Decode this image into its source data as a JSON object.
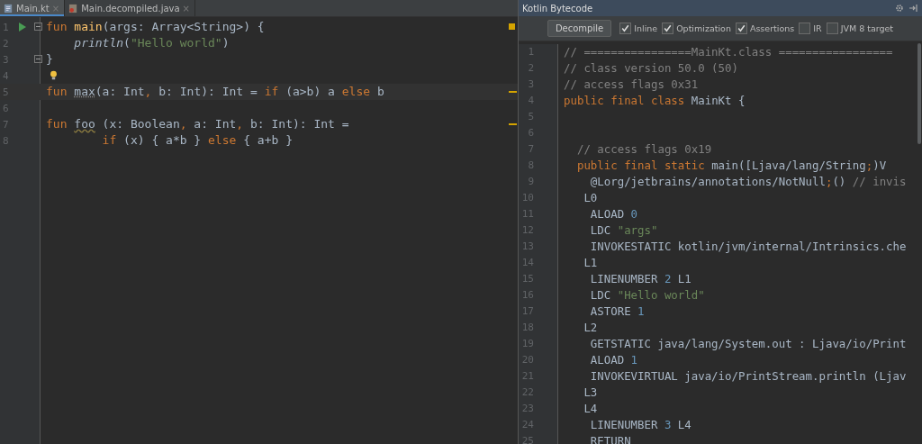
{
  "editor": {
    "tabs": [
      {
        "label": "Main.kt",
        "close": "×",
        "selected": true,
        "kind": "kotlin"
      },
      {
        "label": "Main.decompiled.java",
        "close": "×",
        "selected": false,
        "kind": "java"
      }
    ],
    "lines": [
      {
        "number": "1",
        "run": true,
        "fold_start": true,
        "fold_end": false,
        "bulb": false,
        "current": false,
        "warning": false,
        "tokens": [
          {
            "kind": "keyword",
            "text": "fun "
          },
          {
            "kind": "function",
            "text": "main"
          },
          {
            "kind": "plain",
            "text": "(args: Array<String>) {"
          }
        ]
      },
      {
        "number": "2",
        "run": false,
        "fold_start": false,
        "fold_end": false,
        "bulb": false,
        "current": false,
        "warning": false,
        "tokens": [
          {
            "kind": "italic",
            "text": "    println"
          },
          {
            "kind": "plain",
            "text": "("
          },
          {
            "kind": "string",
            "text": "\"Hello world\""
          },
          {
            "kind": "plain",
            "text": ")"
          }
        ]
      },
      {
        "number": "3",
        "run": false,
        "fold_start": false,
        "fold_end": true,
        "bulb": false,
        "current": false,
        "warning": false,
        "tokens": [
          {
            "kind": "plain",
            "text": "}"
          }
        ]
      },
      {
        "number": "4",
        "run": false,
        "fold_start": false,
        "fold_end": false,
        "bulb": true,
        "current": false,
        "warning": false
      },
      {
        "number": "5",
        "run": false,
        "fold_start": false,
        "fold_end": false,
        "bulb": false,
        "current": true,
        "warning": true,
        "tokens": [
          {
            "kind": "keyword",
            "text": "fun "
          },
          {
            "kind": "dotted",
            "text": "max"
          },
          {
            "kind": "plain",
            "text": "(a: Int"
          },
          {
            "kind": "keyword",
            "text": ","
          },
          {
            "kind": "plain",
            "text": " b: Int): Int = "
          },
          {
            "kind": "keyword",
            "text": "if"
          },
          {
            "kind": "plain",
            "text": " (a>b) a "
          },
          {
            "kind": "keyword",
            "text": "else"
          },
          {
            "kind": "plain",
            "text": " b"
          }
        ]
      },
      {
        "number": "6",
        "run": false,
        "fold_start": false,
        "fold_end": false,
        "bulb": false,
        "current": false,
        "warning": false
      },
      {
        "number": "7",
        "run": false,
        "fold_start": false,
        "fold_end": false,
        "bulb": false,
        "current": false,
        "warning": true,
        "tokens": [
          {
            "kind": "keyword",
            "text": "fun "
          },
          {
            "kind": "wavy",
            "text": "foo"
          },
          {
            "kind": "plain",
            "text": " (x: Boolean"
          },
          {
            "kind": "keyword",
            "text": ","
          },
          {
            "kind": "plain",
            "text": " a: Int"
          },
          {
            "kind": "keyword",
            "text": ","
          },
          {
            "kind": "plain",
            "text": " b: Int): Int ="
          }
        ]
      },
      {
        "number": "8",
        "run": false,
        "fold_start": false,
        "fold_end": false,
        "bulb": false,
        "current": false,
        "warning": false,
        "tokens": [
          {
            "kind": "keyword",
            "text": "        if"
          },
          {
            "kind": "plain",
            "text": " (x) { a*b } "
          },
          {
            "kind": "keyword",
            "text": "else"
          },
          {
            "kind": "plain",
            "text": " { a+b }"
          }
        ]
      }
    ]
  },
  "bytecode": {
    "title": "Kotlin Bytecode",
    "decompile": "Decompile",
    "options": [
      {
        "label": "Inline",
        "checked": true
      },
      {
        "label": "Optimization",
        "checked": true
      },
      {
        "label": "Assertions",
        "checked": true
      },
      {
        "label": "IR",
        "checked": false
      },
      {
        "label": "JVM 8 target",
        "checked": false
      }
    ],
    "lines": [
      {
        "number": "1",
        "tokens": [
          {
            "kind": "comment",
            "text": "// ================MainKt.class ================="
          }
        ]
      },
      {
        "number": "2",
        "tokens": [
          {
            "kind": "comment",
            "text": "// class version 50.0 (50)"
          }
        ]
      },
      {
        "number": "3",
        "tokens": [
          {
            "kind": "comment",
            "text": "// access flags 0x31"
          }
        ]
      },
      {
        "number": "4",
        "tokens": [
          {
            "kind": "keyword",
            "text": "public final class "
          },
          {
            "kind": "plain",
            "text": "MainKt {"
          }
        ]
      },
      {
        "number": "5"
      },
      {
        "number": "6"
      },
      {
        "number": "7",
        "tokens": [
          {
            "kind": "comment",
            "text": "  // access flags 0x19"
          }
        ]
      },
      {
        "number": "8",
        "tokens": [
          {
            "kind": "keyword",
            "text": "  public final static "
          },
          {
            "kind": "plain",
            "text": "main([Ljava/lang/String"
          },
          {
            "kind": "keyword",
            "text": ";"
          },
          {
            "kind": "plain",
            "text": ")V"
          }
        ]
      },
      {
        "number": "9",
        "tokens": [
          {
            "kind": "plain",
            "text": "    @Lorg/jetbrains/annotations/NotNull"
          },
          {
            "kind": "keyword",
            "text": ";"
          },
          {
            "kind": "plain",
            "text": "() "
          },
          {
            "kind": "comment",
            "text": "// invis"
          }
        ]
      },
      {
        "number": "10",
        "tokens": [
          {
            "kind": "plain",
            "text": "   L0"
          }
        ]
      },
      {
        "number": "11",
        "tokens": [
          {
            "kind": "plain",
            "text": "    ALOAD "
          },
          {
            "kind": "number",
            "text": "0"
          }
        ]
      },
      {
        "number": "12",
        "tokens": [
          {
            "kind": "plain",
            "text": "    LDC "
          },
          {
            "kind": "string",
            "text": "\"args\""
          }
        ]
      },
      {
        "number": "13",
        "tokens": [
          {
            "kind": "plain",
            "text": "    INVOKESTATIC kotlin/jvm/internal/Intrinsics.che"
          }
        ]
      },
      {
        "number": "14",
        "tokens": [
          {
            "kind": "plain",
            "text": "   L1"
          }
        ]
      },
      {
        "number": "15",
        "tokens": [
          {
            "kind": "plain",
            "text": "    LINENUMBER "
          },
          {
            "kind": "number",
            "text": "2"
          },
          {
            "kind": "plain",
            "text": " L1"
          }
        ]
      },
      {
        "number": "16",
        "tokens": [
          {
            "kind": "plain",
            "text": "    LDC "
          },
          {
            "kind": "string",
            "text": "\"Hello world\""
          }
        ]
      },
      {
        "number": "17",
        "tokens": [
          {
            "kind": "plain",
            "text": "    ASTORE "
          },
          {
            "kind": "number",
            "text": "1"
          }
        ]
      },
      {
        "number": "18",
        "tokens": [
          {
            "kind": "plain",
            "text": "   L2"
          }
        ]
      },
      {
        "number": "19",
        "tokens": [
          {
            "kind": "plain",
            "text": "    GETSTATIC java/lang/System.out : Ljava/io/Print"
          }
        ]
      },
      {
        "number": "20",
        "tokens": [
          {
            "kind": "plain",
            "text": "    ALOAD "
          },
          {
            "kind": "number",
            "text": "1"
          }
        ]
      },
      {
        "number": "21",
        "tokens": [
          {
            "kind": "plain",
            "text": "    INVOKEVIRTUAL java/io/PrintStream.println (Ljav"
          }
        ]
      },
      {
        "number": "22",
        "tokens": [
          {
            "kind": "plain",
            "text": "   L3"
          }
        ]
      },
      {
        "number": "23",
        "tokens": [
          {
            "kind": "plain",
            "text": "   L4"
          }
        ]
      },
      {
        "number": "24",
        "tokens": [
          {
            "kind": "plain",
            "text": "    LINENUMBER "
          },
          {
            "kind": "number",
            "text": "3"
          },
          {
            "kind": "plain",
            "text": " L4"
          }
        ]
      },
      {
        "number": "25",
        "tokens": [
          {
            "kind": "plain",
            "text": "    RETURN"
          }
        ]
      }
    ]
  }
}
